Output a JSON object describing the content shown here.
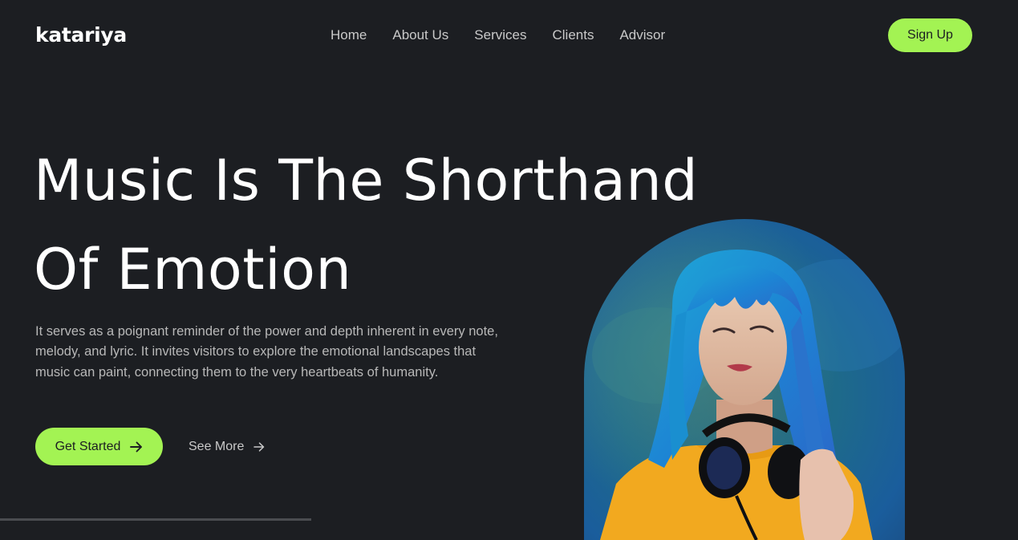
{
  "brand": {
    "logo_text": "katariya"
  },
  "nav": {
    "items": [
      {
        "label": "Home"
      },
      {
        "label": "About Us"
      },
      {
        "label": "Services"
      },
      {
        "label": "Clients"
      },
      {
        "label": "Advisor"
      }
    ],
    "signup_label": "Sign Up"
  },
  "hero": {
    "title_line1": "Music Is The Shorthand",
    "title_line2": "Of Emotion",
    "description": "It serves as a poignant reminder of the power and depth inherent in every note, melody, and lyric. It invites visitors to explore the emotional landscapes that music can paint, connecting them to the very heartbeats of humanity.",
    "primary_cta": "Get Started",
    "secondary_cta": "See More"
  },
  "icons": {
    "primary_arrow": "arrow-right-icon",
    "secondary_arrow": "arrow-right-icon"
  },
  "colors": {
    "background": "#1c1e22",
    "accent": "#a3f353",
    "text_primary": "#ffffff",
    "text_muted": "#b8b8b8"
  }
}
